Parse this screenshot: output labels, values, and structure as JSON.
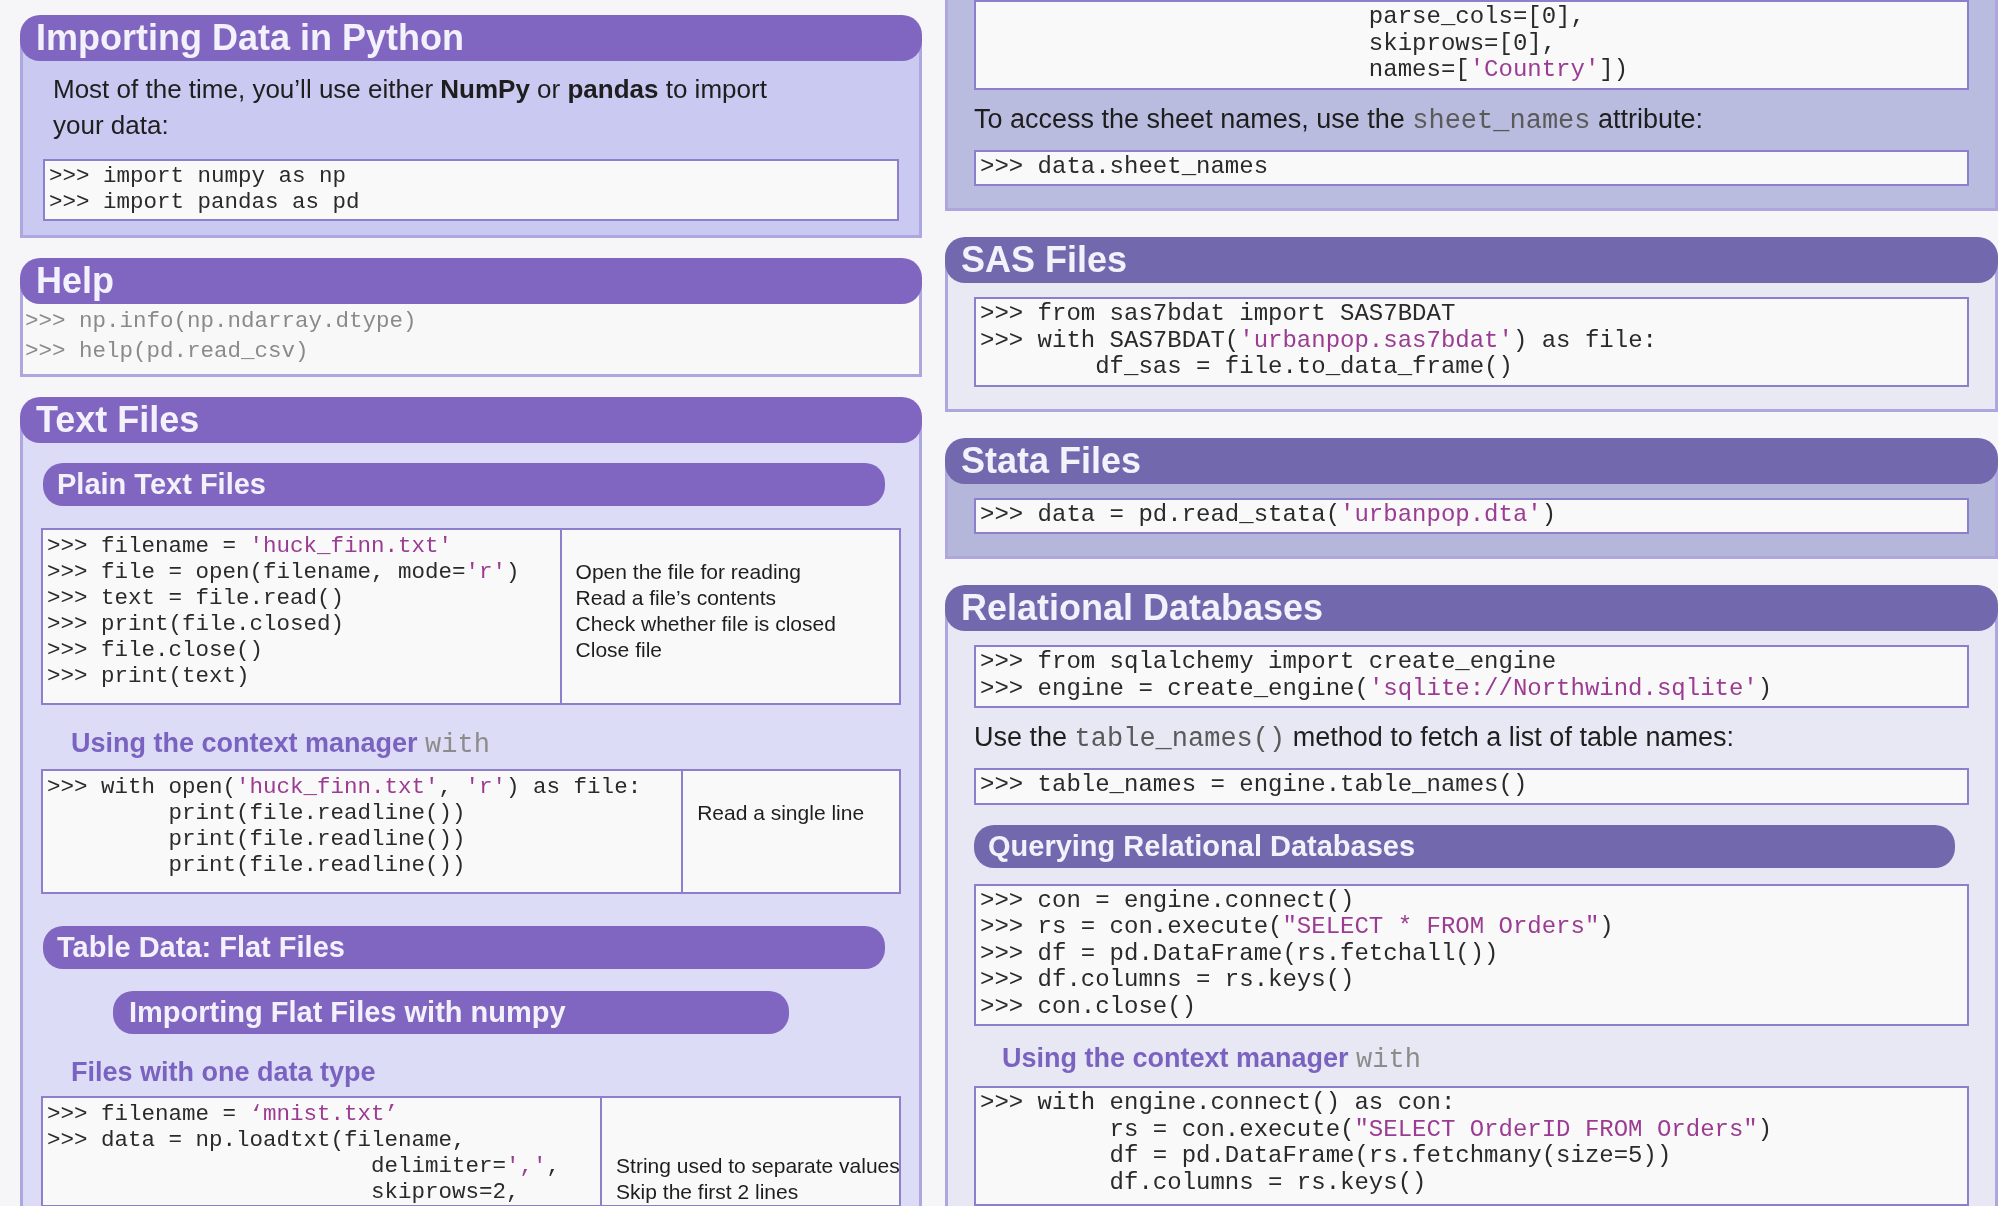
{
  "columns": [
    {
      "color": "#8066c0",
      "sections": [
        {
          "title": "Importing Data in Python",
          "color": "#c9c9f1",
          "content": [
            {
              "kind": "paragraph",
              "text": "Most of the time, you’ll use either **NumPy** or **pandas** to import your data:"
            },
            {
              "kind": "code",
              "lines": [
                [
                  {
                    "kind": "plain",
                    "text": ">>> import numpy as np"
                  }
                ],
                [
                  {
                    "kind": "plain",
                    "text": ">>> import pandas as pd"
                  }
                ]
              ]
            }
          ]
        },
        {
          "title": "Help",
          "color": "#f8f8f8",
          "content": [
            {
              "kind": "bare_code",
              "lines": [
                [
                  {
                    "kind": "dim",
                    "text": ">>> np.info(np.ndarray.dtype)"
                  }
                ],
                [
                  {
                    "kind": "dim",
                    "text": ">>> help(pd.read_csv)"
                  }
                ]
              ]
            }
          ]
        },
        {
          "title": "Text Files",
          "color": "#dcdcf6",
          "content": [
            {
              "kind": "banner",
              "text": "Plain Text Files"
            },
            {
              "kind": "table",
              "rows": [
                {
                  "code": [
                    {
                      "kind": "plain",
                      "text": ">>> filename = "
                    },
                    {
                      "kind": "string",
                      "text": "'huck_finn.txt'"
                    }
                  ]
                },
                {
                  "code": [
                    {
                      "kind": "plain",
                      "text": ">>> file = open(filename, mode="
                    },
                    {
                      "kind": "string",
                      "text": "'r'"
                    },
                    {
                      "kind": "plain",
                      "text": ")"
                    }
                  ],
                  "note": "Open the file for reading"
                },
                {
                  "code": [
                    {
                      "kind": "plain",
                      "text": ">>> text = file.read()"
                    }
                  ],
                  "note": "Read a file’s contents"
                },
                {
                  "code": [
                    {
                      "kind": "plain",
                      "text": ">>> print(file.closed)"
                    }
                  ],
                  "note": "Check whether file is closed"
                },
                {
                  "code": [
                    {
                      "kind": "plain",
                      "text": ">>> file.close()"
                    }
                  ],
                  "note": "Close file"
                },
                {
                  "code": [
                    {
                      "kind": "plain",
                      "text": ">>> print(text)"
                    }
                  ]
                }
              ]
            },
            {
              "kind": "label",
              "text": "Using the context manager",
              "code": "with"
            },
            {
              "kind": "table",
              "rows": [
                {
                  "code": [
                    {
                      "kind": "plain",
                      "text": ">>> with open("
                    },
                    {
                      "kind": "string",
                      "text": "'huck_finn.txt'"
                    },
                    {
                      "kind": "plain",
                      "text": ", "
                    },
                    {
                      "kind": "string",
                      "text": "'r'"
                    },
                    {
                      "kind": "plain",
                      "text": ") as file:"
                    }
                  ]
                },
                {
                  "code": [
                    {
                      "kind": "plain",
                      "text": "         print(file.readline())"
                    }
                  ],
                  "note": "Read a single line"
                },
                {
                  "code": [
                    {
                      "kind": "plain",
                      "text": "         print(file.readline())"
                    }
                  ]
                },
                {
                  "code": [
                    {
                      "kind": "plain",
                      "text": "         print(file.readline())"
                    }
                  ]
                }
              ]
            },
            {
              "kind": "banner",
              "text": "Table Data: Flat Files"
            },
            {
              "kind": "subbanner",
              "text": "Importing Flat Files with numpy"
            },
            {
              "kind": "label",
              "text": "Files with one data type"
            },
            {
              "kind": "table",
              "rows": [
                {
                  "code": [
                    {
                      "kind": "plain",
                      "text": ">>> filename = "
                    },
                    {
                      "kind": "string",
                      "text": "‘mnist.txt’"
                    }
                  ]
                },
                {
                  "code": [
                    {
                      "kind": "plain",
                      "text": ">>> data = np.loadtxt(filename,"
                    }
                  ]
                },
                {
                  "code": [
                    {
                      "kind": "plain",
                      "text": "                        delimiter="
                    },
                    {
                      "kind": "string",
                      "text": "','"
                    },
                    {
                      "kind": "plain",
                      "text": ","
                    }
                  ],
                  "note": "String used to separate values"
                },
                {
                  "code": [
                    {
                      "kind": "plain",
                      "text": "                        skiprows=2,"
                    }
                  ],
                  "note": "Skip the first 2 lines"
                }
              ]
            }
          ]
        }
      ]
    },
    {
      "color": "#7268ad",
      "sections": [
        {
          "color": "#b9bcdf",
          "content": [
            {
              "kind": "code",
              "lines": [
                [
                  {
                    "kind": "plain",
                    "text": "                           parse_cols=[0],"
                  }
                ],
                [
                  {
                    "kind": "plain",
                    "text": "                           skiprows=[0],"
                  }
                ],
                [
                  {
                    "kind": "plain",
                    "text": "                           names=["
                  },
                  {
                    "kind": "string",
                    "text": "'Country'"
                  },
                  {
                    "kind": "plain",
                    "text": "])"
                  }
                ]
              ]
            },
            {
              "kind": "paragraph",
              "text": "To access the sheet names, use the",
              "code": "sheet_names",
              "after": "attribute:"
            },
            {
              "kind": "code",
              "lines": [
                [
                  {
                    "kind": "plain",
                    "text": ">>> data.sheet_names"
                  }
                ]
              ]
            }
          ]
        },
        {
          "title": "SAS Files",
          "color": "#e9e9f3",
          "content": [
            {
              "kind": "code",
              "lines": [
                [
                  {
                    "kind": "plain",
                    "text": ">>> from sas7bdat import SAS7BDAT"
                  }
                ],
                [
                  {
                    "kind": "plain",
                    "text": ">>> with SAS7BDAT("
                  },
                  {
                    "kind": "string",
                    "text": "'urbanpop.sas7bdat'"
                  },
                  {
                    "kind": "plain",
                    "text": ") as file:"
                  }
                ],
                [
                  {
                    "kind": "plain",
                    "text": "        df_sas = file.to_data_frame()"
                  }
                ]
              ]
            }
          ]
        },
        {
          "title": "Stata Files",
          "color": "#b4b6da",
          "content": [
            {
              "kind": "code",
              "lines": [
                [
                  {
                    "kind": "plain",
                    "text": ">>> data = pd.read_stata("
                  },
                  {
                    "kind": "string",
                    "text": "'urbanpop.dta'"
                  },
                  {
                    "kind": "plain",
                    "text": ")"
                  }
                ]
              ]
            }
          ]
        },
        {
          "title": "Relational Databases",
          "color": "#e8e8f4",
          "content": [
            {
              "kind": "code",
              "lines": [
                [
                  {
                    "kind": "plain",
                    "text": ">>> from sqlalchemy import create_engine"
                  }
                ],
                [
                  {
                    "kind": "plain",
                    "text": ">>> engine = create_engine("
                  },
                  {
                    "kind": "string",
                    "text": "'sqlite://Northwind.sqlite'"
                  },
                  {
                    "kind": "plain",
                    "text": ")"
                  }
                ]
              ]
            },
            {
              "kind": "paragraph",
              "text": "Use the",
              "code": "table_names()",
              "after": "method to fetch a list of table names:"
            },
            {
              "kind": "code",
              "lines": [
                [
                  {
                    "kind": "plain",
                    "text": ">>> table_names = engine.table_names()"
                  }
                ]
              ]
            },
            {
              "kind": "banner",
              "text": "Querying Relational Databases"
            },
            {
              "kind": "code",
              "lines": [
                [
                  {
                    "kind": "plain",
                    "text": ">>> con = engine.connect()"
                  }
                ],
                [
                  {
                    "kind": "plain",
                    "text": ">>> rs = con.execute("
                  },
                  {
                    "kind": "string",
                    "text": "\"SELECT * FROM Orders\""
                  },
                  {
                    "kind": "plain",
                    "text": ")"
                  }
                ],
                [
                  {
                    "kind": "plain",
                    "text": ">>> df = pd.DataFrame(rs.fetchall())"
                  }
                ],
                [
                  {
                    "kind": "plain",
                    "text": ">>> df.columns = rs.keys()"
                  }
                ],
                [
                  {
                    "kind": "plain",
                    "text": ">>> con.close()"
                  }
                ]
              ]
            },
            {
              "kind": "label",
              "text": "Using the context manager",
              "code": "with"
            },
            {
              "kind": "code",
              "lines": [
                [
                  {
                    "kind": "plain",
                    "text": ">>> with engine.connect() as con:"
                  }
                ],
                [
                  {
                    "kind": "plain",
                    "text": "         rs = con.execute("
                  },
                  {
                    "kind": "string",
                    "text": "\"SELECT OrderID FROM Orders\""
                  },
                  {
                    "kind": "plain",
                    "text": ")"
                  }
                ],
                [
                  {
                    "kind": "plain",
                    "text": "         df = pd.DataFrame(rs.fetchmany(size=5))"
                  }
                ],
                [
                  {
                    "kind": "plain",
                    "text": "         df.columns = rs.keys()"
                  }
                ]
              ]
            }
          ]
        }
      ]
    }
  ]
}
